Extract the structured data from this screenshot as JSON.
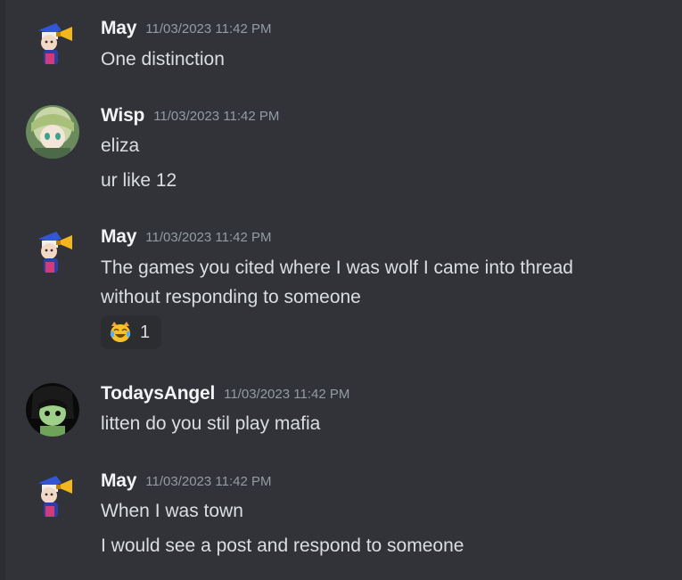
{
  "messages": [
    {
      "username": "May",
      "timestamp": "11/03/2023 11:42 PM",
      "avatar_icon": "megaphone-character-avatar",
      "lines": [
        "One distinction"
      ]
    },
    {
      "username": "Wisp",
      "timestamp": "11/03/2023 11:42 PM",
      "avatar_icon": "anime-character-avatar",
      "lines": [
        "eliza",
        "ur like 12"
      ]
    },
    {
      "username": "May",
      "timestamp": "11/03/2023 11:42 PM",
      "avatar_icon": "megaphone-character-avatar",
      "lines": [
        "The games you cited where I was wolf I came into thread",
        "without responding to someone"
      ],
      "reaction": {
        "emoji": "joy-cat-icon",
        "count": "1"
      }
    },
    {
      "username": "TodaysAngel",
      "timestamp": "11/03/2023 11:42 PM",
      "avatar_icon": "dark-green-character-avatar",
      "lines": [
        "litten do you stil play mafia"
      ]
    },
    {
      "username": "May",
      "timestamp": "11/03/2023 11:42 PM",
      "avatar_icon": "megaphone-character-avatar",
      "lines": [
        "When I was town",
        "I would see a post and respond to someone"
      ]
    }
  ]
}
